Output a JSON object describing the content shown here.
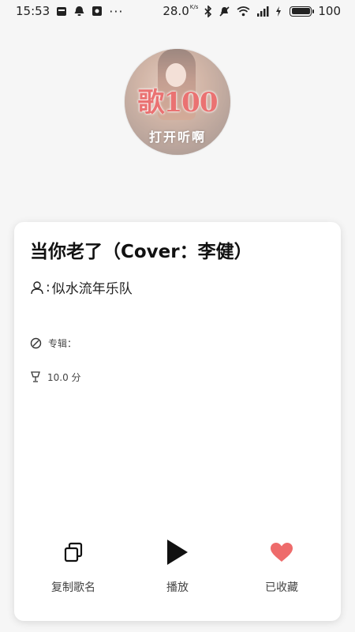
{
  "status_bar": {
    "time": "15:53",
    "network_speed": "28.0",
    "network_speed_unit": "K/s",
    "battery": "100"
  },
  "cover": {
    "title_text": "歌100",
    "sub_text": "打开听啊"
  },
  "song": {
    "title": "当你老了（Cover：李健）",
    "artist_prefix": ":",
    "artist": "似水流年乐队",
    "album_label": "专辑：",
    "album_value": "",
    "score": "10.0 分"
  },
  "actions": {
    "copy_label": "复制歌名",
    "play_label": "播放",
    "favorite_label": "已收藏"
  },
  "colors": {
    "favorite_heart": "#ee6b6b",
    "cover_title": "#e23c3c"
  }
}
